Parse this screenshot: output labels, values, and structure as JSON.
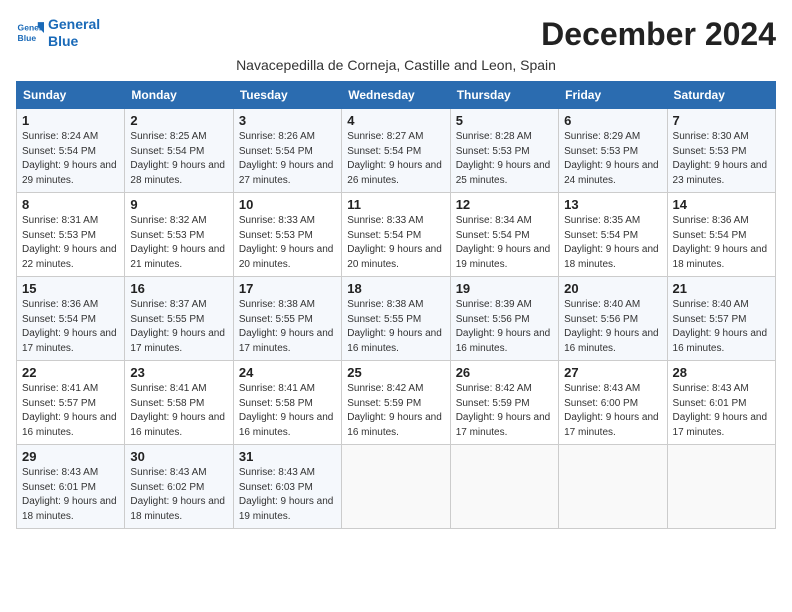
{
  "logo": {
    "line1": "General",
    "line2": "Blue"
  },
  "title": "December 2024",
  "subtitle": "Navacepedilla de Corneja, Castille and Leon, Spain",
  "columns": [
    "Sunday",
    "Monday",
    "Tuesday",
    "Wednesday",
    "Thursday",
    "Friday",
    "Saturday"
  ],
  "weeks": [
    [
      {
        "day": "1",
        "rise": "Sunrise: 8:24 AM",
        "set": "Sunset: 5:54 PM",
        "daylight": "Daylight: 9 hours and 29 minutes."
      },
      {
        "day": "2",
        "rise": "Sunrise: 8:25 AM",
        "set": "Sunset: 5:54 PM",
        "daylight": "Daylight: 9 hours and 28 minutes."
      },
      {
        "day": "3",
        "rise": "Sunrise: 8:26 AM",
        "set": "Sunset: 5:54 PM",
        "daylight": "Daylight: 9 hours and 27 minutes."
      },
      {
        "day": "4",
        "rise": "Sunrise: 8:27 AM",
        "set": "Sunset: 5:54 PM",
        "daylight": "Daylight: 9 hours and 26 minutes."
      },
      {
        "day": "5",
        "rise": "Sunrise: 8:28 AM",
        "set": "Sunset: 5:53 PM",
        "daylight": "Daylight: 9 hours and 25 minutes."
      },
      {
        "day": "6",
        "rise": "Sunrise: 8:29 AM",
        "set": "Sunset: 5:53 PM",
        "daylight": "Daylight: 9 hours and 24 minutes."
      },
      {
        "day": "7",
        "rise": "Sunrise: 8:30 AM",
        "set": "Sunset: 5:53 PM",
        "daylight": "Daylight: 9 hours and 23 minutes."
      }
    ],
    [
      {
        "day": "8",
        "rise": "Sunrise: 8:31 AM",
        "set": "Sunset: 5:53 PM",
        "daylight": "Daylight: 9 hours and 22 minutes."
      },
      {
        "day": "9",
        "rise": "Sunrise: 8:32 AM",
        "set": "Sunset: 5:53 PM",
        "daylight": "Daylight: 9 hours and 21 minutes."
      },
      {
        "day": "10",
        "rise": "Sunrise: 8:33 AM",
        "set": "Sunset: 5:53 PM",
        "daylight": "Daylight: 9 hours and 20 minutes."
      },
      {
        "day": "11",
        "rise": "Sunrise: 8:33 AM",
        "set": "Sunset: 5:54 PM",
        "daylight": "Daylight: 9 hours and 20 minutes."
      },
      {
        "day": "12",
        "rise": "Sunrise: 8:34 AM",
        "set": "Sunset: 5:54 PM",
        "daylight": "Daylight: 9 hours and 19 minutes."
      },
      {
        "day": "13",
        "rise": "Sunrise: 8:35 AM",
        "set": "Sunset: 5:54 PM",
        "daylight": "Daylight: 9 hours and 18 minutes."
      },
      {
        "day": "14",
        "rise": "Sunrise: 8:36 AM",
        "set": "Sunset: 5:54 PM",
        "daylight": "Daylight: 9 hours and 18 minutes."
      }
    ],
    [
      {
        "day": "15",
        "rise": "Sunrise: 8:36 AM",
        "set": "Sunset: 5:54 PM",
        "daylight": "Daylight: 9 hours and 17 minutes."
      },
      {
        "day": "16",
        "rise": "Sunrise: 8:37 AM",
        "set": "Sunset: 5:55 PM",
        "daylight": "Daylight: 9 hours and 17 minutes."
      },
      {
        "day": "17",
        "rise": "Sunrise: 8:38 AM",
        "set": "Sunset: 5:55 PM",
        "daylight": "Daylight: 9 hours and 17 minutes."
      },
      {
        "day": "18",
        "rise": "Sunrise: 8:38 AM",
        "set": "Sunset: 5:55 PM",
        "daylight": "Daylight: 9 hours and 16 minutes."
      },
      {
        "day": "19",
        "rise": "Sunrise: 8:39 AM",
        "set": "Sunset: 5:56 PM",
        "daylight": "Daylight: 9 hours and 16 minutes."
      },
      {
        "day": "20",
        "rise": "Sunrise: 8:40 AM",
        "set": "Sunset: 5:56 PM",
        "daylight": "Daylight: 9 hours and 16 minutes."
      },
      {
        "day": "21",
        "rise": "Sunrise: 8:40 AM",
        "set": "Sunset: 5:57 PM",
        "daylight": "Daylight: 9 hours and 16 minutes."
      }
    ],
    [
      {
        "day": "22",
        "rise": "Sunrise: 8:41 AM",
        "set": "Sunset: 5:57 PM",
        "daylight": "Daylight: 9 hours and 16 minutes."
      },
      {
        "day": "23",
        "rise": "Sunrise: 8:41 AM",
        "set": "Sunset: 5:58 PM",
        "daylight": "Daylight: 9 hours and 16 minutes."
      },
      {
        "day": "24",
        "rise": "Sunrise: 8:41 AM",
        "set": "Sunset: 5:58 PM",
        "daylight": "Daylight: 9 hours and 16 minutes."
      },
      {
        "day": "25",
        "rise": "Sunrise: 8:42 AM",
        "set": "Sunset: 5:59 PM",
        "daylight": "Daylight: 9 hours and 16 minutes."
      },
      {
        "day": "26",
        "rise": "Sunrise: 8:42 AM",
        "set": "Sunset: 5:59 PM",
        "daylight": "Daylight: 9 hours and 17 minutes."
      },
      {
        "day": "27",
        "rise": "Sunrise: 8:43 AM",
        "set": "Sunset: 6:00 PM",
        "daylight": "Daylight: 9 hours and 17 minutes."
      },
      {
        "day": "28",
        "rise": "Sunrise: 8:43 AM",
        "set": "Sunset: 6:01 PM",
        "daylight": "Daylight: 9 hours and 17 minutes."
      }
    ],
    [
      {
        "day": "29",
        "rise": "Sunrise: 8:43 AM",
        "set": "Sunset: 6:01 PM",
        "daylight": "Daylight: 9 hours and 18 minutes."
      },
      {
        "day": "30",
        "rise": "Sunrise: 8:43 AM",
        "set": "Sunset: 6:02 PM",
        "daylight": "Daylight: 9 hours and 18 minutes."
      },
      {
        "day": "31",
        "rise": "Sunrise: 8:43 AM",
        "set": "Sunset: 6:03 PM",
        "daylight": "Daylight: 9 hours and 19 minutes."
      },
      null,
      null,
      null,
      null
    ]
  ]
}
